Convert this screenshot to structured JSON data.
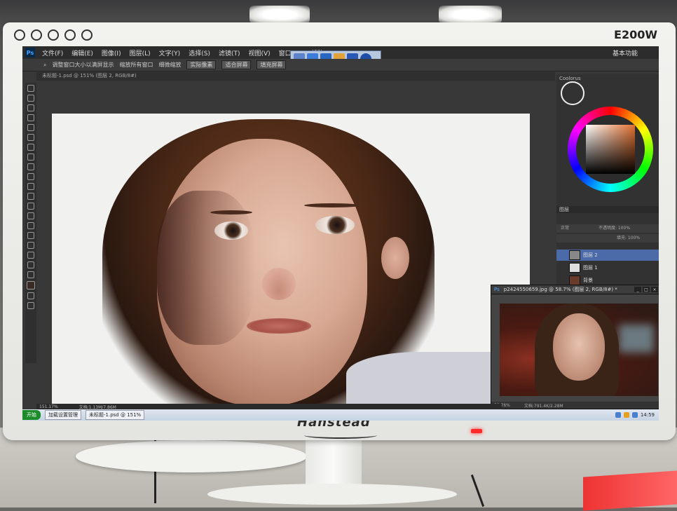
{
  "monitor": {
    "model": "E200W",
    "brand": "Hanstead"
  },
  "photoshop": {
    "menu": [
      "文件(F)",
      "编辑(E)",
      "图像(I)",
      "图层(L)",
      "文字(Y)",
      "选择(S)",
      "滤镜(T)",
      "视图(V)",
      "窗口(W)",
      "帮助(H)"
    ],
    "options": [
      "调整窗口大小以满屏显示",
      "缩放所有窗口",
      "细微缩放",
      "实际像素",
      "适合屏幕",
      "填充屏幕"
    ],
    "workspace": "基本功能",
    "doc_tab": "未标题-1.psd @ 151% (图层 2, RGB/8#)",
    "zoom": "151.17%",
    "doc_size": "文档:1.13M/7.86M",
    "colorpanel_title": "Coolorus",
    "layers_panel_title": "图层",
    "layer_mode": "正常",
    "opacity_label": "不透明度: 100%",
    "fill_label": "填充: 100%",
    "layers": [
      "图层 2",
      "图层 1",
      "背景"
    ]
  },
  "ref_window": {
    "title": "p2424550659.jpg @ 58.7% (图层 2, RGB/8#) *",
    "zoom": "58.76%",
    "doc_size": "文档:791.4K/2.28M"
  },
  "taskbar": {
    "start": "开始",
    "task1": "加载设置管理",
    "task2": "未标题-1.psd @ 151%",
    "clock": "14:59"
  }
}
